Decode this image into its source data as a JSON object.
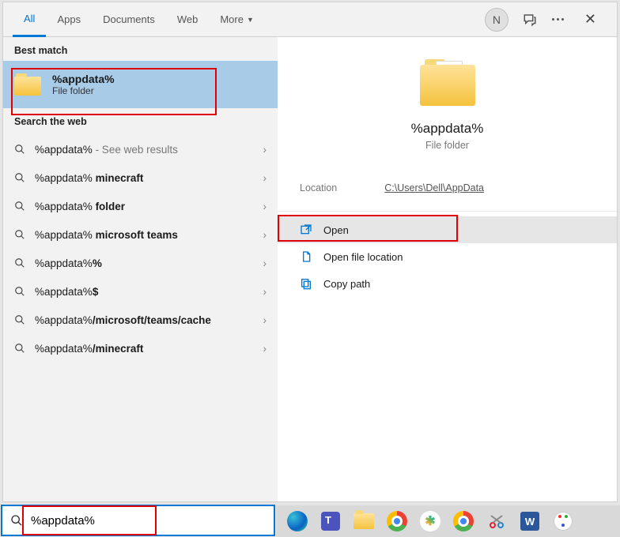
{
  "tabs": [
    "All",
    "Apps",
    "Documents",
    "Web",
    "More"
  ],
  "activeTab": 0,
  "avatar": "N",
  "sections": {
    "bestMatch": "Best match",
    "searchWeb": "Search the web"
  },
  "bestMatch": {
    "title": "%appdata%",
    "subtitle": "File folder"
  },
  "webResults": [
    {
      "plain": "%appdata%",
      "bold": "",
      "suffix": " - See web results"
    },
    {
      "plain": "%appdata% ",
      "bold": "minecraft",
      "suffix": ""
    },
    {
      "plain": "%appdata% ",
      "bold": "folder",
      "suffix": ""
    },
    {
      "plain": "%appdata% ",
      "bold": "microsoft teams",
      "suffix": ""
    },
    {
      "plain": "%appdata%",
      "bold": "%",
      "suffix": ""
    },
    {
      "plain": "%appdata%",
      "bold": "$",
      "suffix": ""
    },
    {
      "plain": "%appdata%",
      "bold": "/microsoft/teams/cache",
      "suffix": ""
    },
    {
      "plain": "%appdata%",
      "bold": "/minecraft",
      "suffix": ""
    }
  ],
  "preview": {
    "title": "%appdata%",
    "subtitle": "File folder",
    "locationLabel": "Location",
    "locationPath": "C:\\Users\\Dell\\AppData"
  },
  "actions": [
    {
      "label": "Open",
      "icon": "open"
    },
    {
      "label": "Open file location",
      "icon": "location"
    },
    {
      "label": "Copy path",
      "icon": "copy"
    }
  ],
  "searchValue": "%appdata%",
  "taskbarIcons": [
    "edge",
    "teams",
    "explorer",
    "chrome",
    "slack",
    "chrome2",
    "snip",
    "word",
    "paint"
  ]
}
